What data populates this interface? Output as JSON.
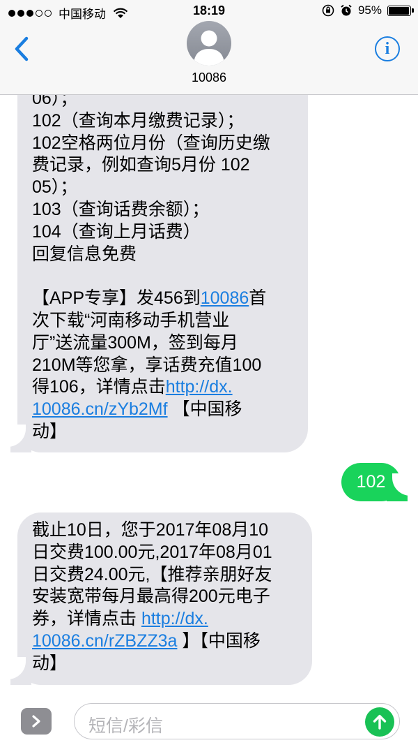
{
  "status_bar": {
    "carrier": "中国移动",
    "time": "18:19",
    "battery": "95%",
    "battery_level": 0.95
  },
  "nav": {
    "back_icon": "chevron-left-icon",
    "contact_name": "10086",
    "info_icon": "i",
    "accent_color": "#1a7ee0"
  },
  "messages": [
    {
      "direction": "incoming",
      "lines": [
        "06）；",
        "102（查询本月缴费记录）；",
        "102空格两位月份（查询历史缴",
        "费记录，例如查询5月份 102",
        "05）；",
        "103（查询话费余额）；",
        "104（查询上月话费）",
        "回复信息免费"
      ],
      "promo": {
        "l1_a": "【APP专享】发456到",
        "l1_link": "10086",
        "l1_b": "首",
        "l2": "次下载“河南移动手机营业",
        "l3": "厅”送流量300M，签到每月",
        "l4": "210M等您拿，享话费充值100",
        "l5_a": "得106，详情点击",
        "l5_link": "http://dx.",
        "l6_link": "10086.cn/zYb2Mf",
        "l6_b": " 【中国移",
        "l7": "动】"
      }
    },
    {
      "direction": "outgoing",
      "text": "102"
    },
    {
      "direction": "incoming",
      "lines": [
        "截止10日，您于2017年08月10",
        "日交费100.00元,2017年08月01",
        "日交费24.00元,【推荐亲朋好友",
        "安装宽带每月最高得200元电子"
      ],
      "l5_a": "券，详情点击 ",
      "l5_link": "http://dx.",
      "l6_link": "10086.cn/rZBZZ3a",
      "l6_b": " 】【中国移",
      "l7": "动】"
    }
  ],
  "input": {
    "placeholder": "短信/彩信",
    "bubble_in_color": "#e5e5ea",
    "bubble_out_color": "#19d35b",
    "link_color": "#1a7ee0"
  }
}
